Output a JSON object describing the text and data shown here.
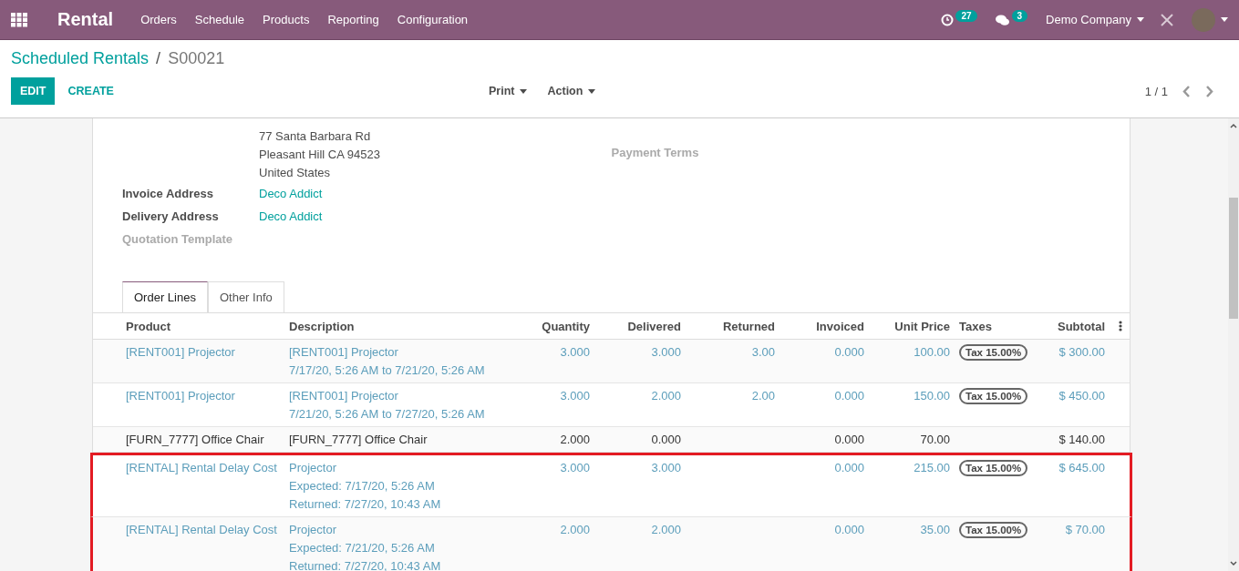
{
  "navbar": {
    "app_title": "Rental",
    "menu": [
      "Orders",
      "Schedule",
      "Products",
      "Reporting",
      "Configuration"
    ],
    "activity_count": "27",
    "message_count": "3",
    "company": "Demo Company"
  },
  "breadcrumb": {
    "parent": "Scheduled Rentals",
    "separator": "/",
    "current": "S00021"
  },
  "buttons": {
    "edit": "EDIT",
    "create": "CREATE"
  },
  "dropdowns": [
    "Print",
    "Action"
  ],
  "pager": "1 / 1",
  "form": {
    "address_lines": [
      "77 Santa Barbara Rd",
      "Pleasant Hill CA 94523",
      "United States"
    ],
    "fields": [
      {
        "label": "Invoice Address",
        "value": "Deco Addict",
        "filled": true
      },
      {
        "label": "Delivery Address",
        "value": "Deco Addict",
        "filled": true
      },
      {
        "label": "Quotation Template",
        "filled": false
      }
    ],
    "right_fields": [
      {
        "label": "Payment Terms",
        "filled": false
      }
    ]
  },
  "tabs": [
    {
      "label": "Order Lines",
      "selected": true
    },
    {
      "label": "Other Info",
      "selected": false
    }
  ],
  "table": {
    "columns": [
      "Product",
      "Description",
      "Quantity",
      "Delivered",
      "Returned",
      "Invoiced",
      "Unit Price",
      "Taxes",
      "Subtotal"
    ],
    "rows": [
      {
        "kind": "rental",
        "highlighted": false,
        "product": "[RENT001] Projector",
        "description": [
          "[RENT001] Projector",
          "7/17/20, 5:26 AM to 7/21/20, 5:26 AM"
        ],
        "quantity": "3.000",
        "delivered": "3.000",
        "returned": "3.00",
        "invoiced": "0.000",
        "unit_price": "100.00",
        "taxes": "Tax 15.00%",
        "subtotal": "$ 300.00"
      },
      {
        "kind": "rental",
        "highlighted": false,
        "product": "[RENT001] Projector",
        "description": [
          "[RENT001] Projector",
          "7/21/20, 5:26 AM to 7/27/20, 5:26 AM"
        ],
        "quantity": "3.000",
        "delivered": "2.000",
        "returned": "2.00",
        "invoiced": "0.000",
        "unit_price": "150.00",
        "taxes": "Tax 15.00%",
        "subtotal": "$ 450.00"
      },
      {
        "kind": "product",
        "highlighted": false,
        "product": "[FURN_7777] Office Chair",
        "description": [
          "[FURN_7777] Office Chair"
        ],
        "quantity": "2.000",
        "delivered": "0.000",
        "invoiced": "0.000",
        "unit_price": "70.00",
        "subtotal": "$ 140.00"
      },
      {
        "kind": "rental",
        "highlighted": true,
        "product": "[RENTAL] Rental Delay Cost",
        "description": [
          "Projector",
          "Expected: 7/17/20, 5:26 AM",
          "Returned: 7/27/20, 10:43 AM"
        ],
        "quantity": "3.000",
        "delivered": "3.000",
        "invoiced": "0.000",
        "unit_price": "215.00",
        "taxes": "Tax 15.00%",
        "subtotal": "$ 645.00"
      },
      {
        "kind": "rental",
        "highlighted": true,
        "product": "[RENTAL] Rental Delay Cost",
        "description": [
          "Projector",
          "Expected: 7/21/20, 5:26 AM",
          "Returned: 7/27/20, 10:43 AM"
        ],
        "quantity": "2.000",
        "delivered": "2.000",
        "invoiced": "0.000",
        "unit_price": "35.00",
        "taxes": "Tax 15.00%",
        "subtotal": "$ 70.00"
      }
    ]
  }
}
